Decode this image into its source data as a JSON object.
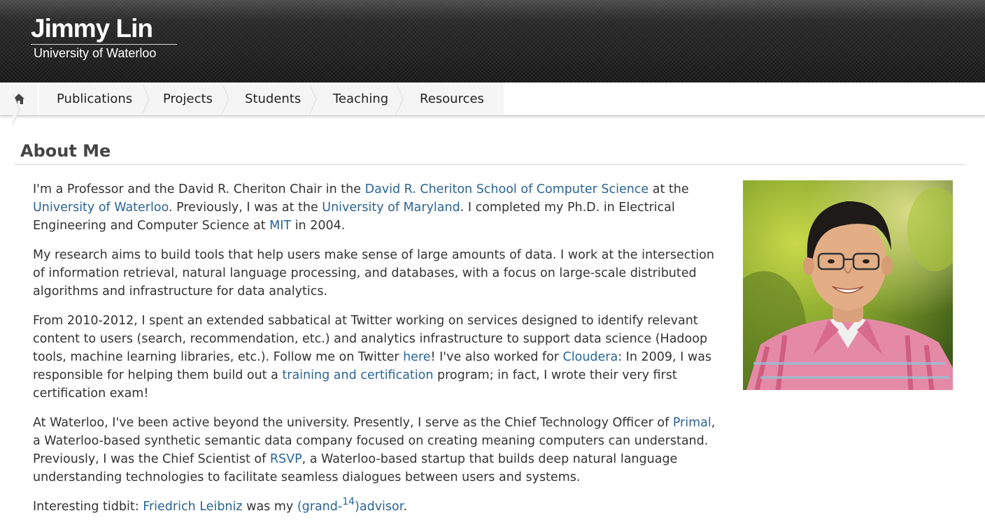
{
  "header": {
    "name": "Jimmy Lin",
    "affiliation": "University of Waterloo"
  },
  "nav": {
    "home_icon": "home-icon",
    "items": [
      "Publications",
      "Projects",
      "Students",
      "Teaching",
      "Resources"
    ]
  },
  "main": {
    "title": "About Me",
    "p1": {
      "t1": "I'm a Professor and the David R. Cheriton Chair in the ",
      "l1": "David R. Cheriton School of Computer Science",
      "t2": " at the ",
      "l2": "University of Waterloo",
      "t3": ". Previously, I was at the ",
      "l3": "University of Maryland",
      "t4": ". I completed my Ph.D. in Electrical Engineering and Computer Science at ",
      "l4": "MIT",
      "t5": " in 2004."
    },
    "p2": {
      "t1": "My research aims to build tools that help users make sense of large amounts of data. I work at the intersection of information retrieval, natural language processing, and databases, with a focus on large-scale distributed algorithms and infrastructure for data analytics."
    },
    "p3": {
      "t1": "From 2010-2012, I spent an extended sabbatical at Twitter working on services designed to identify relevant content to users (search, recommendation, etc.) and analytics infrastructure to support data science (Hadoop tools, machine learning libraries, etc.). Follow me on Twitter ",
      "l1": "here",
      "t2": "! I've also worked for ",
      "l2": "Cloudera",
      "t3": ": In 2009, I was responsible for helping them build out a ",
      "l3": "training and certification",
      "t4": " program; in fact, I wrote their very first certification exam!"
    },
    "p4": {
      "t1": "At Waterloo, I've been active beyond the university. Presently, I serve as the Chief Technology Officer of ",
      "l1": "Primal",
      "t2": ", a Waterloo-based synthetic semantic data company focused on creating meaning computers can understand. Previously, I was the Chief Scientist of ",
      "l2": "RSVP",
      "t3": ", a Waterloo-based startup that builds deep natural language understanding technologies to facilitate seamless dialogues between users and systems."
    },
    "p5": {
      "t1": "Interesting tidbit: ",
      "l1": "Friedrich Leibniz",
      "t2": " was my ",
      "l2a": "(grand-",
      "l2sup": "14",
      "l2b": ")advisor",
      "t3": "."
    }
  },
  "colors": {
    "link": "#2a6496",
    "header_bg": "#1c1c1c",
    "nav_bg": "#f5f5f5",
    "text": "#333333",
    "heading": "#444444"
  }
}
